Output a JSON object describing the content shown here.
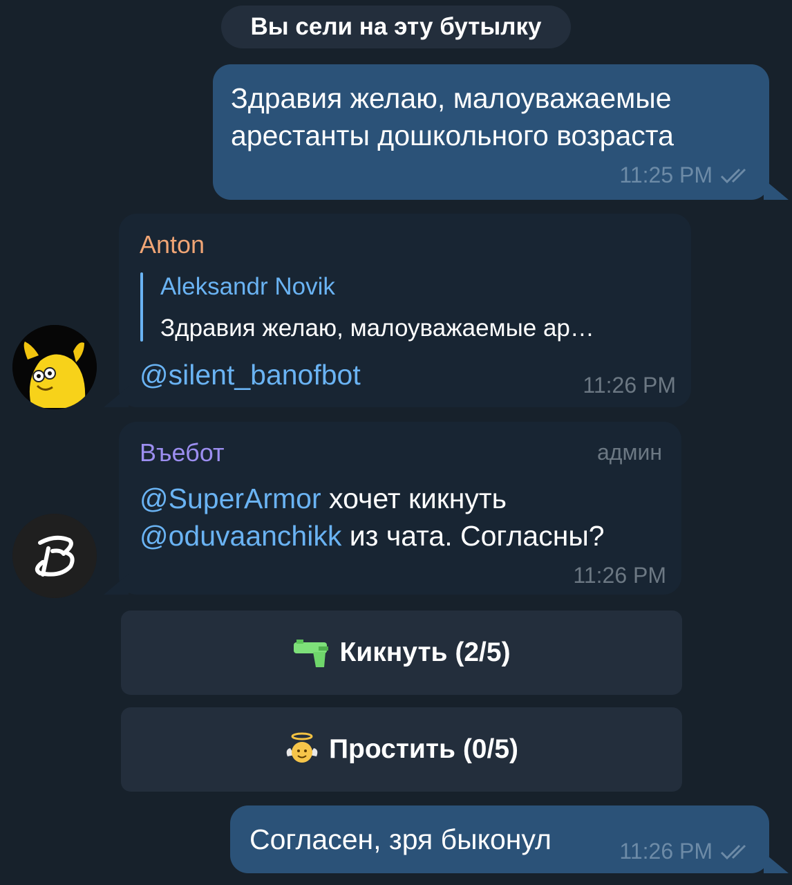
{
  "service_message": "Вы сели на эту бутылку",
  "messages": [
    {
      "text": "Здравия желаю, малоуважаемые арестанты дошкольного возраста",
      "time": "11:25 PM"
    },
    {
      "sender": "Anton",
      "reply_author": "Aleksandr Novik",
      "reply_text": "Здравия желаю, малоуважаемые ар…",
      "text": "@silent_banofbot",
      "time": "11:26 PM"
    },
    {
      "sender": "Въебот",
      "badge": "админ",
      "mention1": "@SuperArmor",
      "text_part1": " хочет кикнуть",
      "mention2": "@oduvaanchikk",
      "text_part2": " из чата. Согласны?",
      "time": "11:26 PM"
    },
    {
      "text": "Согласен, зря быконул",
      "time": "11:26 PM"
    }
  ],
  "keyboard": [
    {
      "icon": "water-pistol-icon",
      "label": "Кикнуть (2/5)"
    },
    {
      "icon": "angel-face-icon",
      "label": "Простить (0/5)"
    }
  ],
  "avatars": {
    "bot_letter": "B"
  },
  "colors": {
    "background": "#17212b",
    "outgoing": "#2b5278",
    "incoming": "#182533",
    "sender_anton": "#f0a575",
    "sender_bot": "#9c8ef0",
    "link": "#6ab3f3"
  }
}
